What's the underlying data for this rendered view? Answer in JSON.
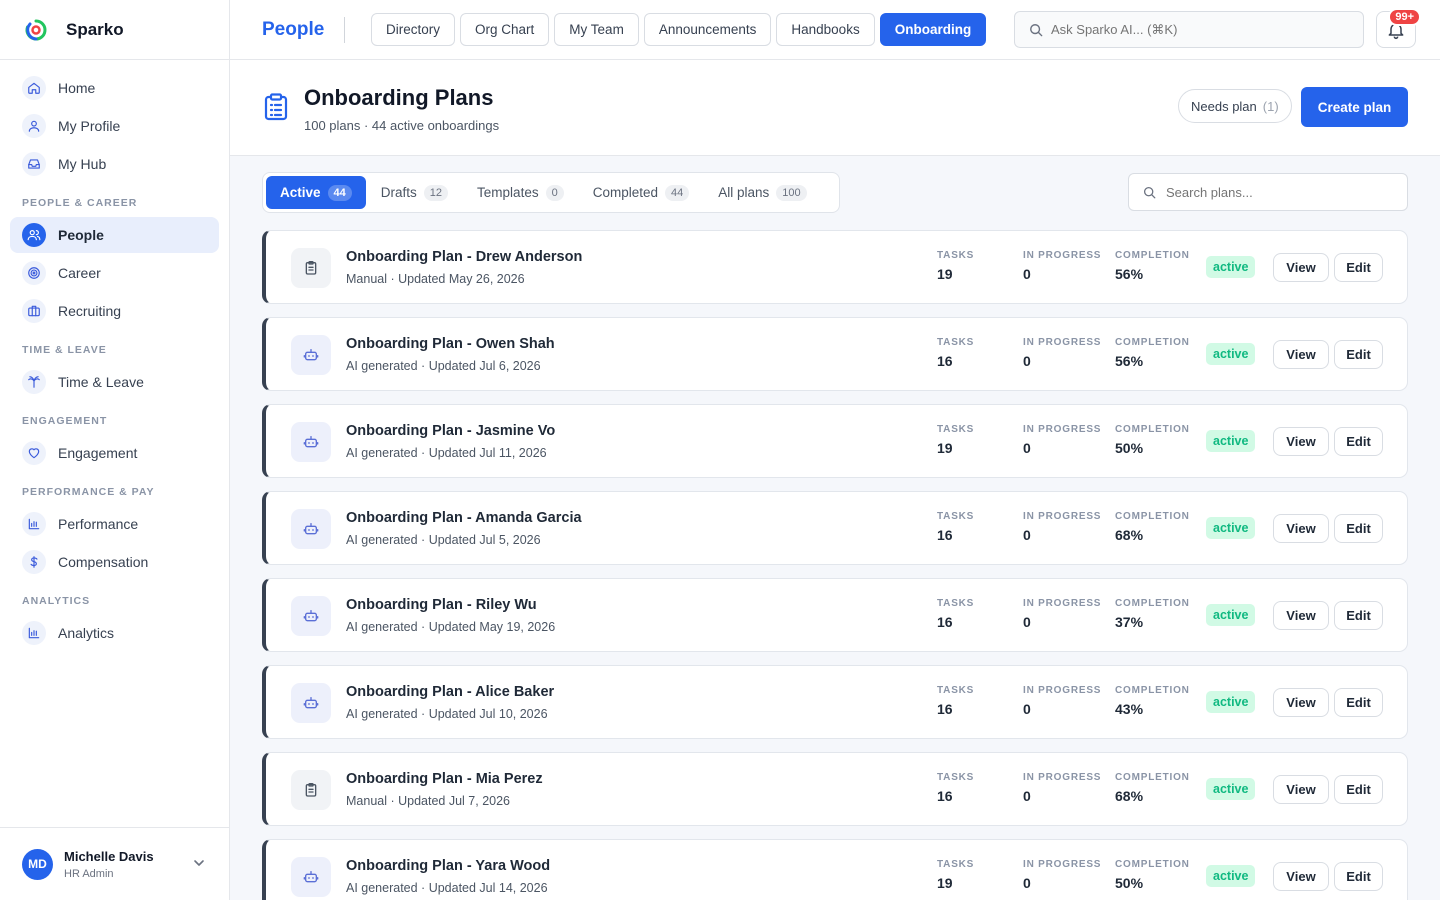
{
  "brand": {
    "name": "Sparko"
  },
  "sidebar": {
    "top_items": [
      {
        "label": "Home",
        "icon": "home-icon"
      },
      {
        "label": "My Profile",
        "icon": "user-icon"
      },
      {
        "label": "My Hub",
        "icon": "inbox-icon"
      }
    ],
    "sections": [
      {
        "title": "PEOPLE & CAREER",
        "items": [
          {
            "label": "People",
            "icon": "users-icon",
            "active": true
          },
          {
            "label": "Career",
            "icon": "target-icon"
          },
          {
            "label": "Recruiting",
            "icon": "briefcase-icon"
          }
        ]
      },
      {
        "title": "TIME & LEAVE",
        "items": [
          {
            "label": "Time & Leave",
            "icon": "palm-tree-icon"
          }
        ]
      },
      {
        "title": "ENGAGEMENT",
        "items": [
          {
            "label": "Engagement",
            "icon": "heart-icon"
          }
        ]
      },
      {
        "title": "PERFORMANCE & PAY",
        "items": [
          {
            "label": "Performance",
            "icon": "bar-chart-icon"
          },
          {
            "label": "Compensation",
            "icon": "dollar-icon"
          }
        ]
      },
      {
        "title": "ANALYTICS",
        "items": [
          {
            "label": "Analytics",
            "icon": "bar-chart-icon"
          }
        ]
      }
    ]
  },
  "user": {
    "initials": "MD",
    "name": "Michelle Davis",
    "role": "HR Admin"
  },
  "topbar": {
    "title": "People",
    "tabs": [
      {
        "label": "Directory"
      },
      {
        "label": "Org Chart"
      },
      {
        "label": "My Team"
      },
      {
        "label": "Announcements"
      },
      {
        "label": "Handbooks"
      },
      {
        "label": "Onboarding",
        "active": true
      }
    ],
    "search_placeholder": "Ask Sparko AI... (⌘K)",
    "notification_badge": "99+"
  },
  "header": {
    "title": "Onboarding Plans",
    "subtitle": "100 plans · 44 active onboardings",
    "needs_plan_label": "Needs plan",
    "needs_plan_count": "(1)",
    "create_label": "Create plan"
  },
  "filters": {
    "tabs": [
      {
        "label": "Active",
        "count": "44",
        "active": true
      },
      {
        "label": "Drafts",
        "count": "12"
      },
      {
        "label": "Templates",
        "count": "0"
      },
      {
        "label": "Completed",
        "count": "44"
      },
      {
        "label": "All plans",
        "count": "100"
      }
    ],
    "search_placeholder": "Search plans..."
  },
  "stat_labels": {
    "tasks": "TASKS",
    "in_progress": "IN PROGRESS",
    "completion": "COMPLETION"
  },
  "actions": {
    "view": "View",
    "edit": "Edit"
  },
  "colors": {
    "accent": "#2563eb",
    "active_badge_bg": "#d1fae5",
    "active_badge_text": "#10b981"
  },
  "plans": [
    {
      "title": "Onboarding Plan - Drew Anderson",
      "meta": "Manual · Updated May 26, 2026",
      "kind": "manual",
      "tasks": "19",
      "in_progress": "0",
      "completion": "56%",
      "status": "active"
    },
    {
      "title": "Onboarding Plan - Owen Shah",
      "meta": "AI generated · Updated Jul 6, 2026",
      "kind": "ai",
      "tasks": "16",
      "in_progress": "0",
      "completion": "56%",
      "status": "active"
    },
    {
      "title": "Onboarding Plan - Jasmine Vo",
      "meta": "AI generated · Updated Jul 11, 2026",
      "kind": "ai",
      "tasks": "19",
      "in_progress": "0",
      "completion": "50%",
      "status": "active"
    },
    {
      "title": "Onboarding Plan - Amanda Garcia",
      "meta": "AI generated · Updated Jul 5, 2026",
      "kind": "ai",
      "tasks": "16",
      "in_progress": "0",
      "completion": "68%",
      "status": "active"
    },
    {
      "title": "Onboarding Plan - Riley Wu",
      "meta": "AI generated · Updated May 19, 2026",
      "kind": "ai",
      "tasks": "16",
      "in_progress": "0",
      "completion": "37%",
      "status": "active"
    },
    {
      "title": "Onboarding Plan - Alice Baker",
      "meta": "AI generated · Updated Jul 10, 2026",
      "kind": "ai",
      "tasks": "16",
      "in_progress": "0",
      "completion": "43%",
      "status": "active"
    },
    {
      "title": "Onboarding Plan - Mia Perez",
      "meta": "Manual · Updated Jul 7, 2026",
      "kind": "manual",
      "tasks": "16",
      "in_progress": "0",
      "completion": "68%",
      "status": "active"
    },
    {
      "title": "Onboarding Plan - Yara Wood",
      "meta": "AI generated · Updated Jul 14, 2026",
      "kind": "ai",
      "tasks": "19",
      "in_progress": "0",
      "completion": "50%",
      "status": "active"
    }
  ]
}
